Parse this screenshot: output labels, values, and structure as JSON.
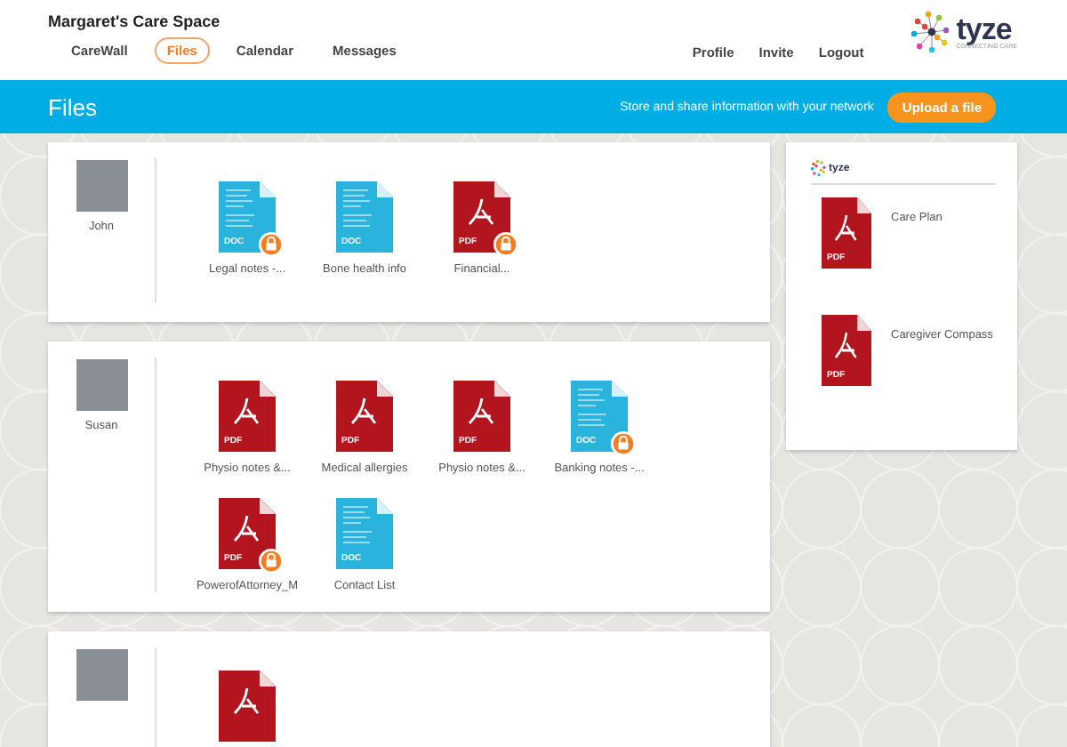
{
  "header": {
    "title": "Margaret's Care Space",
    "nav": [
      {
        "label": "CareWall",
        "selected": false
      },
      {
        "label": "Files",
        "selected": true
      },
      {
        "label": "Calendar",
        "selected": false
      },
      {
        "label": "Messages",
        "selected": false
      }
    ],
    "user_links": [
      "Profile",
      "Invite",
      "Logout"
    ],
    "logo": {
      "name": "tyze",
      "tagline": "CONNECTING CARE"
    }
  },
  "banner": {
    "title": "Files",
    "subtitle": "Store and share information with your network",
    "button": "Upload a file"
  },
  "members": [
    {
      "name": "John",
      "files": [
        {
          "kind": "doc",
          "type_label": "DOC",
          "name": "Legal notes -...",
          "locked": true
        },
        {
          "kind": "doc",
          "type_label": "DOC",
          "name": "Bone health info",
          "locked": false
        },
        {
          "kind": "pdf",
          "type_label": "PDF",
          "name": "Financial...",
          "locked": true
        }
      ]
    },
    {
      "name": "Susan",
      "files": [
        {
          "kind": "pdf",
          "type_label": "PDF",
          "name": "Physio notes &...",
          "locked": false
        },
        {
          "kind": "pdf",
          "type_label": "PDF",
          "name": "Medical allergies",
          "locked": false
        },
        {
          "kind": "pdf",
          "type_label": "PDF",
          "name": "Physio notes &...",
          "locked": false
        },
        {
          "kind": "doc",
          "type_label": "DOC",
          "name": "Banking notes -...",
          "locked": true
        },
        {
          "kind": "pdf",
          "type_label": "PDF",
          "name": "PowerofAttorney_M",
          "locked": true
        },
        {
          "kind": "doc",
          "type_label": "DOC",
          "name": "Contact List",
          "locked": false
        }
      ]
    },
    {
      "files": [
        {
          "kind": "pdf",
          "locked": false
        }
      ]
    }
  ],
  "sidebar": {
    "logo": "tyze",
    "resources": [
      {
        "kind": "pdf",
        "type_label": "PDF",
        "name": "Care Plan"
      },
      {
        "kind": "pdf",
        "type_label": "PDF",
        "name": "Caregiver Compass"
      }
    ]
  }
}
